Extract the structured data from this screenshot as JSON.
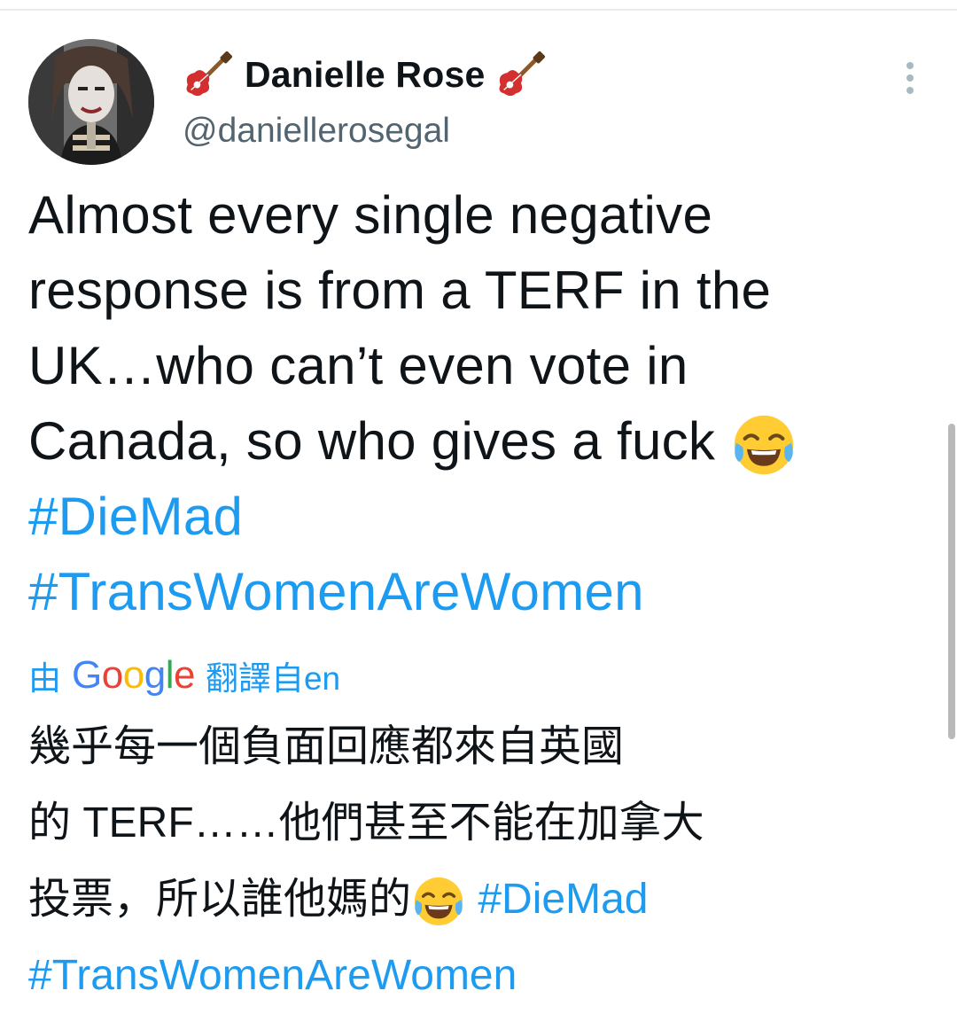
{
  "author": {
    "name_emoji_left": "guitar",
    "display_name": "Danielle Rose",
    "name_emoji_right": "guitar",
    "handle": "@daniellerosegal"
  },
  "tweet": {
    "line1": "Almost every single negative",
    "line2": "response is from a TERF in the",
    "line3": "UK…who can’t even vote in",
    "line4": "Canada, so who gives a fuck",
    "hashtag1": "#DieMad",
    "hashtag2": "#TransWomenAreWomen"
  },
  "translation": {
    "prefix": "由",
    "provider_letters": [
      "G",
      "o",
      "o",
      "g",
      "l",
      "e"
    ],
    "suffix": "翻譯自en",
    "line1": "幾乎每一個負面回應都來自英國",
    "line2": "的 TERF……他們甚至不能在加拿大",
    "line3": "投票，所以誰他媽的",
    "hashtag1": "#DieMad",
    "hashtag2": "#TransWomenAreWomen"
  },
  "icons": {
    "more": "more-vertical-icon",
    "emoji": "face-with-tears-of-joy-icon"
  },
  "colors": {
    "link": "#1d9bf0",
    "text": "#0f1419",
    "secondary": "#536471"
  }
}
